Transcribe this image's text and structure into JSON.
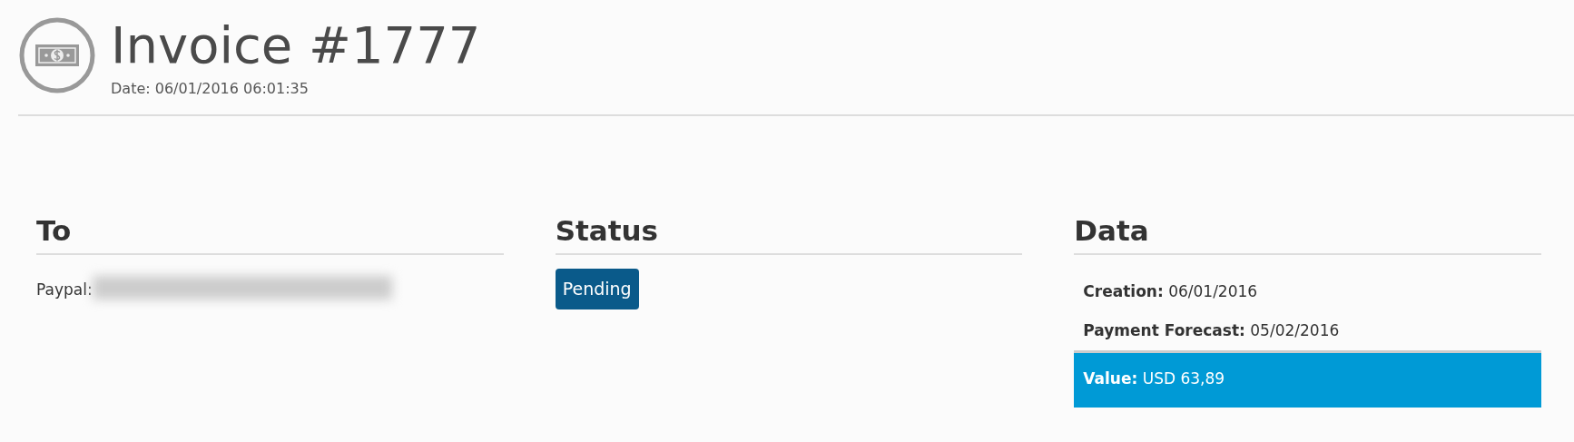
{
  "header": {
    "title": "Invoice #1777",
    "date": "Date: 06/01/2016 06:01:35"
  },
  "sections": [
    {
      "kind": "recipient",
      "heading": "To",
      "label": "Paypal:",
      "redacted": true
    },
    {
      "kind": "status",
      "heading": "Status",
      "badge": "Pending"
    },
    {
      "kind": "details",
      "heading": "Data",
      "rows": [
        {
          "text": "**Creation:** 06/01/2016",
          "highlighted": false
        },
        {
          "text": "**Payment Forecast:** 05/02/2016",
          "highlighted": false
        },
        {
          "text": "**Value:** USD 63,89",
          "highlighted": true
        }
      ]
    }
  ]
}
